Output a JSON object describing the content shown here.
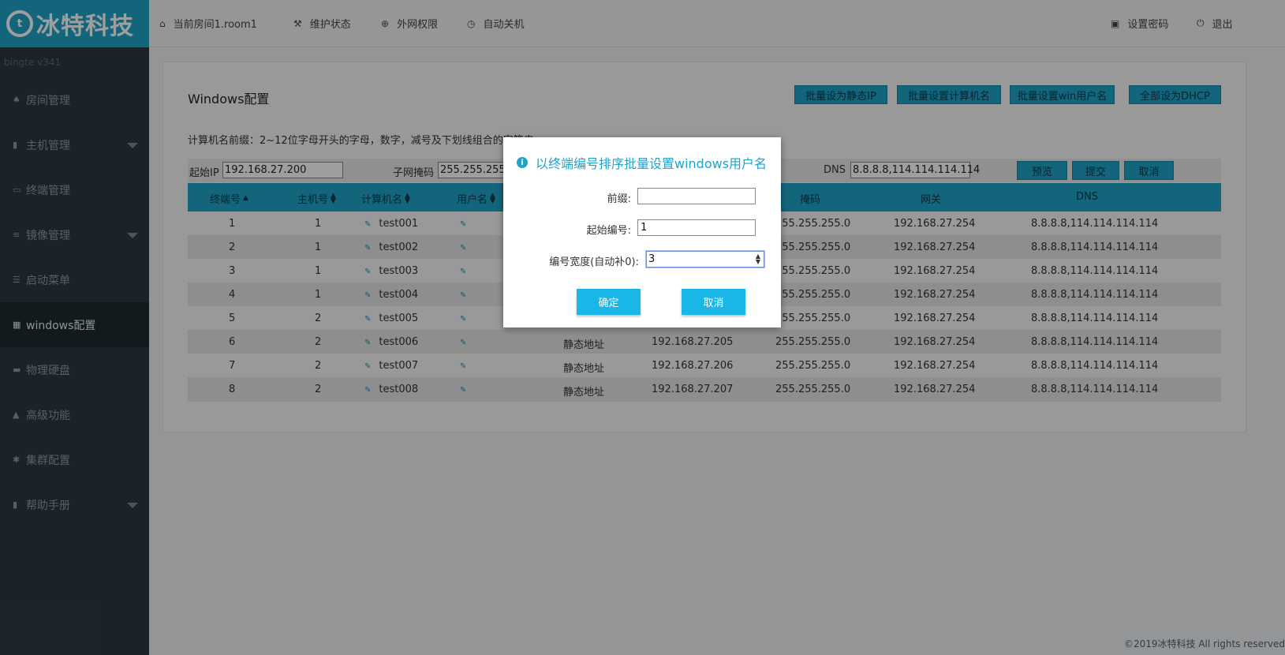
{
  "brand": {
    "logo_glyph": "t",
    "name": "冰特科技",
    "version": "bingte v341"
  },
  "sidebar": {
    "items": [
      {
        "label": "房间管理",
        "icon": "home-icon",
        "glyph": "♠",
        "has_caret": false,
        "active": false
      },
      {
        "label": "主机管理",
        "icon": "server-icon",
        "glyph": "▮",
        "has_caret": true,
        "active": false
      },
      {
        "label": "终端管理",
        "icon": "monitor-icon",
        "glyph": "▭",
        "has_caret": false,
        "active": false
      },
      {
        "label": "镜像管理",
        "icon": "database-icon",
        "glyph": "≡",
        "has_caret": true,
        "active": false
      },
      {
        "label": "启动菜单",
        "icon": "list-icon",
        "glyph": "☰",
        "has_caret": false,
        "active": false
      },
      {
        "label": "windows配置",
        "icon": "windows-icon",
        "glyph": "▦",
        "has_caret": false,
        "active": true
      },
      {
        "label": "物理硬盘",
        "icon": "hdd-icon",
        "glyph": "▬",
        "has_caret": false,
        "active": false
      },
      {
        "label": "高级功能",
        "icon": "warning-icon",
        "glyph": "▲",
        "has_caret": false,
        "active": false
      },
      {
        "label": "集群配置",
        "icon": "gear-icon",
        "glyph": "✱",
        "has_caret": false,
        "active": false
      },
      {
        "label": "帮助手册",
        "icon": "book-icon",
        "glyph": "▮",
        "has_caret": true,
        "active": false
      }
    ]
  },
  "topbar": {
    "room": "当前房间1.room1",
    "maintenance": "维护状态",
    "internet": "外网权限",
    "auto_shutdown": "自动关机",
    "set_password": "设置密码",
    "logout": "退出"
  },
  "main": {
    "title": "Windows配置",
    "buttons": {
      "batch_static_ip": "批量设为静态IP",
      "batch_computer_name": "批量设置计算机名",
      "batch_win_user": "批量设置win用户名",
      "all_dhcp": "全部设为DHCP"
    },
    "hint": "计算机名前缀：2~12位字母开头的字母，数字，减号及下划线组合的字符串",
    "ip_form": {
      "start_ip_label": "起始IP",
      "start_ip_value": "192.168.27.200",
      "mask_label": "子网掩码",
      "mask_value": "255.255.255.0",
      "dns_label": "DNS",
      "dns_value": "8.8.8.8,114.114.114.114",
      "preview": "预览",
      "submit": "提交",
      "cancel": "取消"
    },
    "table": {
      "headers": {
        "terminal_no": "终端号",
        "host_no": "主机号",
        "computer_name": "计算机名",
        "username": "用户名",
        "mask": "掩码",
        "gateway": "网关",
        "dns": "DNS"
      },
      "rows": [
        {
          "terminal": "1",
          "host": "1",
          "name": "test001",
          "mode": "",
          "ip": "",
          "mask": "255.255.255.0",
          "gateway": "192.168.27.254",
          "dns": "8.8.8.8,114.114.114.114"
        },
        {
          "terminal": "2",
          "host": "1",
          "name": "test002",
          "mode": "",
          "ip": "",
          "mask": "255.255.255.0",
          "gateway": "192.168.27.254",
          "dns": "8.8.8.8,114.114.114.114"
        },
        {
          "terminal": "3",
          "host": "1",
          "name": "test003",
          "mode": "",
          "ip": "",
          "mask": "255.255.255.0",
          "gateway": "192.168.27.254",
          "dns": "8.8.8.8,114.114.114.114"
        },
        {
          "terminal": "4",
          "host": "1",
          "name": "test004",
          "mode": "",
          "ip": "",
          "mask": "255.255.255.0",
          "gateway": "192.168.27.254",
          "dns": "8.8.8.8,114.114.114.114"
        },
        {
          "terminal": "5",
          "host": "2",
          "name": "test005",
          "mode": "",
          "ip": "",
          "mask": "255.255.255.0",
          "gateway": "192.168.27.254",
          "dns": "8.8.8.8,114.114.114.114"
        },
        {
          "terminal": "6",
          "host": "2",
          "name": "test006",
          "mode": "静态地址",
          "ip": "192.168.27.205",
          "mask": "255.255.255.0",
          "gateway": "192.168.27.254",
          "dns": "8.8.8.8,114.114.114.114"
        },
        {
          "terminal": "7",
          "host": "2",
          "name": "test007",
          "mode": "静态地址",
          "ip": "192.168.27.206",
          "mask": "255.255.255.0",
          "gateway": "192.168.27.254",
          "dns": "8.8.8.8,114.114.114.114"
        },
        {
          "terminal": "8",
          "host": "2",
          "name": "test008",
          "mode": "静态地址",
          "ip": "192.168.27.207",
          "mask": "255.255.255.0",
          "gateway": "192.168.27.254",
          "dns": "8.8.8.8,114.114.114.114"
        }
      ]
    }
  },
  "modal": {
    "title": "以终端编号排序批量设置windows用户名",
    "prefix_label": "前缀:",
    "prefix_value": "",
    "start_label": "起始编号:",
    "start_value": "1",
    "width_label": "编号宽度(自动补0):",
    "width_value": "3",
    "confirm": "确定",
    "cancel": "取消"
  },
  "footer": "©2019冰特科技 All rights reserved",
  "colors": {
    "accent": "#1fa3c9",
    "sidebar_bg": "#2b3a42",
    "modal_button": "#1ab6e8"
  }
}
